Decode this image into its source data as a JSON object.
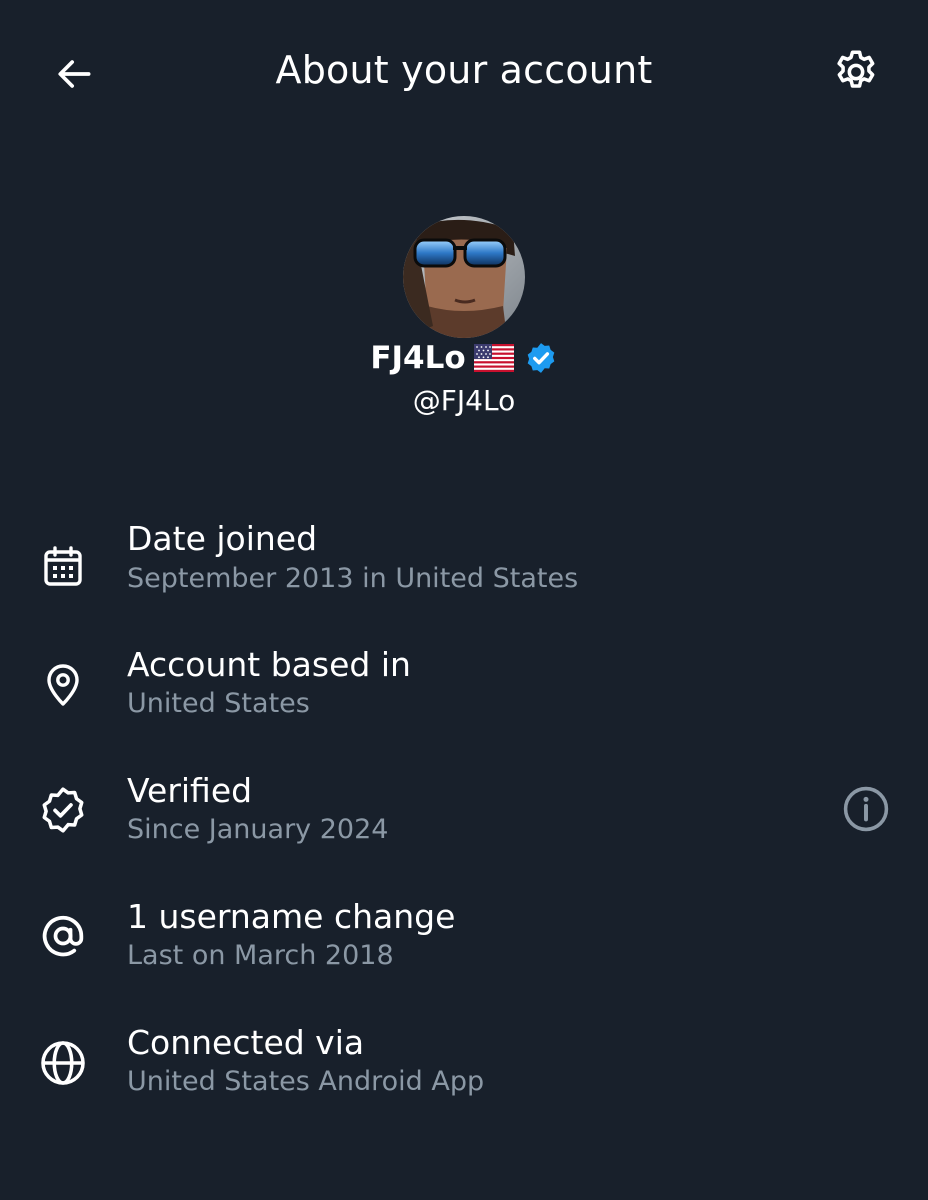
{
  "header": {
    "title": "About your account",
    "back_icon": "arrow-left-icon",
    "settings_icon": "gear-icon"
  },
  "profile": {
    "display_name": "FJ4Lo",
    "flag": "🇺🇸",
    "handle": "@FJ4Lo",
    "verified": true,
    "verified_color": "#1d9bf0"
  },
  "info": [
    {
      "icon": "calendar-icon",
      "title": "Date joined",
      "subtitle": "September 2013 in United States"
    },
    {
      "icon": "location-pin-icon",
      "title": "Account based in",
      "subtitle": "United States"
    },
    {
      "icon": "verified-badge-icon",
      "title": "Verified",
      "subtitle": "Since January 2024",
      "action_icon": "info-icon"
    },
    {
      "icon": "at-sign-icon",
      "title": "1 username change",
      "subtitle": "Last on March 2018"
    },
    {
      "icon": "globe-icon",
      "title": "Connected via",
      "subtitle": "United States Android App"
    }
  ],
  "colors": {
    "background": "#18202b",
    "primary_text": "#ffffff",
    "secondary_text": "#8b98a5",
    "accent": "#1d9bf0"
  }
}
